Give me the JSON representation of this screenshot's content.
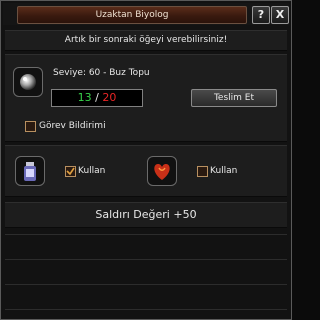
{
  "window": {
    "title": "Uzaktan Biyolog",
    "help_label": "?",
    "close_label": "X"
  },
  "info_text": "Artık bir sonraki öğeyi verebilirsiniz!",
  "quest": {
    "level_text": "Seviye: 60 - Buz Topu",
    "count_current": "13",
    "count_sep": "/",
    "count_required": "20",
    "submit_label": "Teslim Et",
    "notice_label": "Görev Bildirimi",
    "notice_checked": false
  },
  "items": [
    {
      "name": "potion-icon",
      "use_label": "Kullan",
      "checked": true
    },
    {
      "name": "heart-icon",
      "use_label": "Kullan",
      "checked": false
    }
  ],
  "effect_text": "Saldırı Değeri +50",
  "colors": {
    "current": "#37d24a",
    "required": "#e82525",
    "check": "#e0a040"
  }
}
